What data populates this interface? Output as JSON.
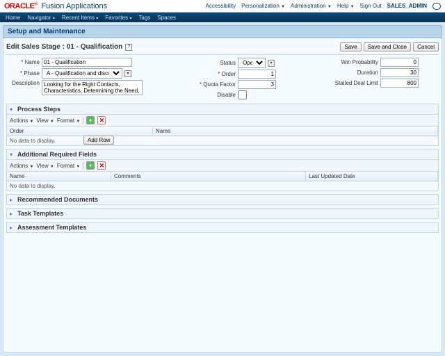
{
  "app": {
    "brand": "ORACLE",
    "name": "Fusion Applications"
  },
  "topnav": {
    "acc": "Accessibility",
    "pers": "Personalization",
    "admin": "Administration",
    "help": "Help",
    "signout": "Sign Out",
    "user": "SALES_ADMIN"
  },
  "menubar": {
    "home": "Home",
    "nav": "Navigator",
    "recent": "Recent Items",
    "fav": "Favorites",
    "tags": "Tags",
    "spaces": "Spaces"
  },
  "page_title": "Setup and Maintenance",
  "panel_title": "Edit Sales Stage : 01 - Qualification",
  "buttons": {
    "save": "Save",
    "save_close": "Save and Close",
    "cancel": "Cancel",
    "add_row": "Add Row"
  },
  "labels": {
    "name": "Name",
    "phase": "Phase",
    "desc": "Description",
    "status": "Status",
    "order": "Order",
    "quota": "Quota Factor",
    "disable": "Disable",
    "winprob": "Win Probability",
    "duration": "Duration",
    "stalled": "Stalled Deal Limit"
  },
  "values": {
    "name": "01 - Qualification",
    "phase": "A - Qualification and discovery",
    "desc": "Looking for the Right Contacts, Characteristics, Determining the Need, Budget and Sponsor",
    "status": "Open",
    "order": "1",
    "quota": "3",
    "winprob": "0",
    "duration": "30",
    "stalled": "800"
  },
  "sections": {
    "ps": {
      "title": "Process Steps",
      "open": true,
      "cols": {
        "order": "Order",
        "name": "Name"
      },
      "empty": "No data to display."
    },
    "arf": {
      "title": "Additional Required Fields",
      "open": true,
      "cols": {
        "name": "Name",
        "comments": "Comments",
        "lud": "Last Updated Date"
      },
      "empty": "No data to display."
    },
    "rd": {
      "title": "Recommended Documents"
    },
    "tt": {
      "title": "Task Templates"
    },
    "at": {
      "title": "Assessment Templates"
    }
  },
  "toolbar": {
    "actions": "Actions",
    "view": "View",
    "format": "Format"
  }
}
